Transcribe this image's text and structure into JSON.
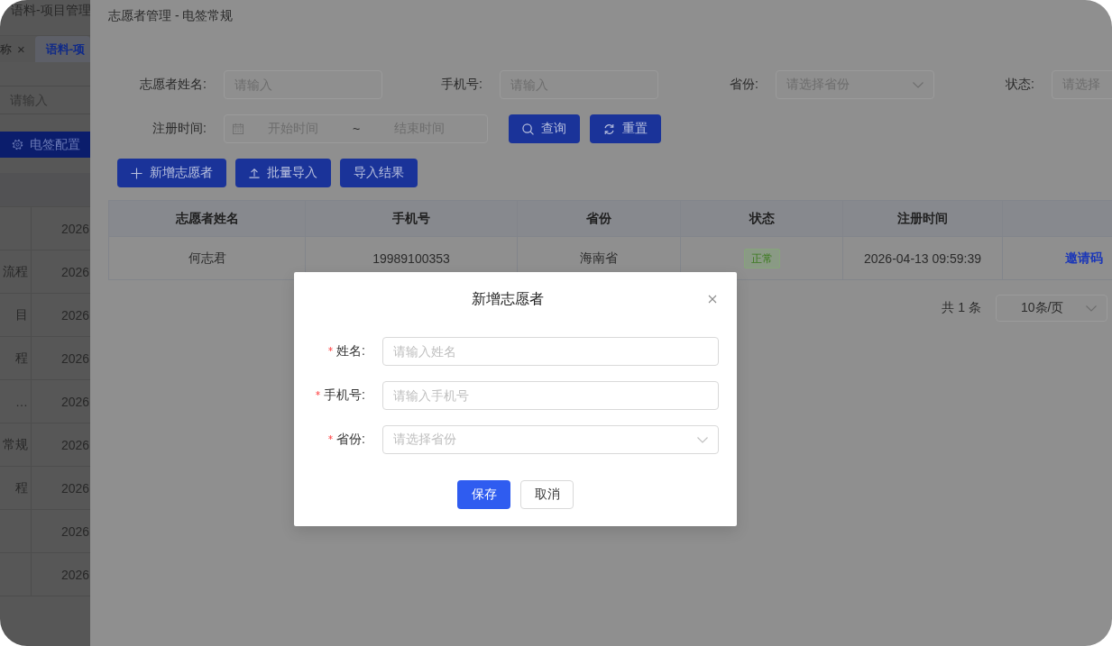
{
  "background_page": {
    "title": "语料-项目管理",
    "tabs": [
      {
        "label": "称",
        "close": "×",
        "selected": false
      },
      {
        "label": "语料-项",
        "selected": true
      }
    ],
    "search": {
      "placeholder": "请输入"
    },
    "config_button": "电签配置",
    "table": {
      "rows": [
        {
          "column_2": "2026"
        },
        {
          "column_1": "流程",
          "column_2": "2026"
        },
        {
          "column_1": "目",
          "column_2": "2026"
        },
        {
          "column_1": "程",
          "column_2": "2026"
        },
        {
          "column_1": "…",
          "column_2": "2026"
        },
        {
          "column_1": "常规",
          "column_2": "2026"
        },
        {
          "column_1": "程",
          "column_2": "2026"
        },
        {
          "column_2": "2026"
        },
        {
          "column_2": "2026"
        }
      ]
    }
  },
  "drawer": {
    "title": "志愿者管理 - 电签常规",
    "filters": [
      {
        "kind": "input",
        "label": "志愿者姓名:",
        "placeholder": "请输入"
      },
      {
        "kind": "input",
        "label": "手机号:",
        "placeholder": "请输入"
      },
      {
        "kind": "select",
        "label": "省份:",
        "placeholder": "请选择省份"
      },
      {
        "kind": "select",
        "label": "状态:",
        "placeholder": "请选择"
      },
      {
        "kind": "date_range",
        "label": "注册时间:",
        "start_placeholder": "开始时间",
        "separator": "~",
        "end_placeholder": "结束时间"
      }
    ],
    "search_actions": [
      {
        "kind": "query",
        "label": "查询"
      },
      {
        "kind": "reset",
        "label": "重置"
      }
    ],
    "toolbar": [
      {
        "kind": "add",
        "label": "新增志愿者"
      },
      {
        "kind": "import",
        "label": "批量导入"
      },
      {
        "kind": "results",
        "label": "导入结果"
      }
    ],
    "table": {
      "columns": [
        "志愿者姓名",
        "手机号",
        "省份",
        "状态",
        "注册时间"
      ],
      "rows": [
        {
          "name": "何志君",
          "phone": "19989100353",
          "province": "海南省",
          "status": "正常",
          "registered_at": "2026-04-13 09:59:39",
          "column_6": "邀请码"
        }
      ]
    },
    "pagination": {
      "total": "共 1 条",
      "page_size": "10条/页"
    }
  },
  "dialog": {
    "title": "新增志愿者",
    "fields": [
      {
        "kind": "input",
        "label": "姓名:",
        "placeholder": "请输入姓名",
        "required": true
      },
      {
        "kind": "input",
        "label": "手机号:",
        "placeholder": "请输入手机号",
        "required": true
      },
      {
        "kind": "select",
        "label": "省份:",
        "placeholder": "请选择省份",
        "required": true
      }
    ],
    "buttons": [
      {
        "kind": "primary",
        "label": "保存"
      },
      {
        "kind": "default",
        "label": "取消"
      }
    ]
  }
}
